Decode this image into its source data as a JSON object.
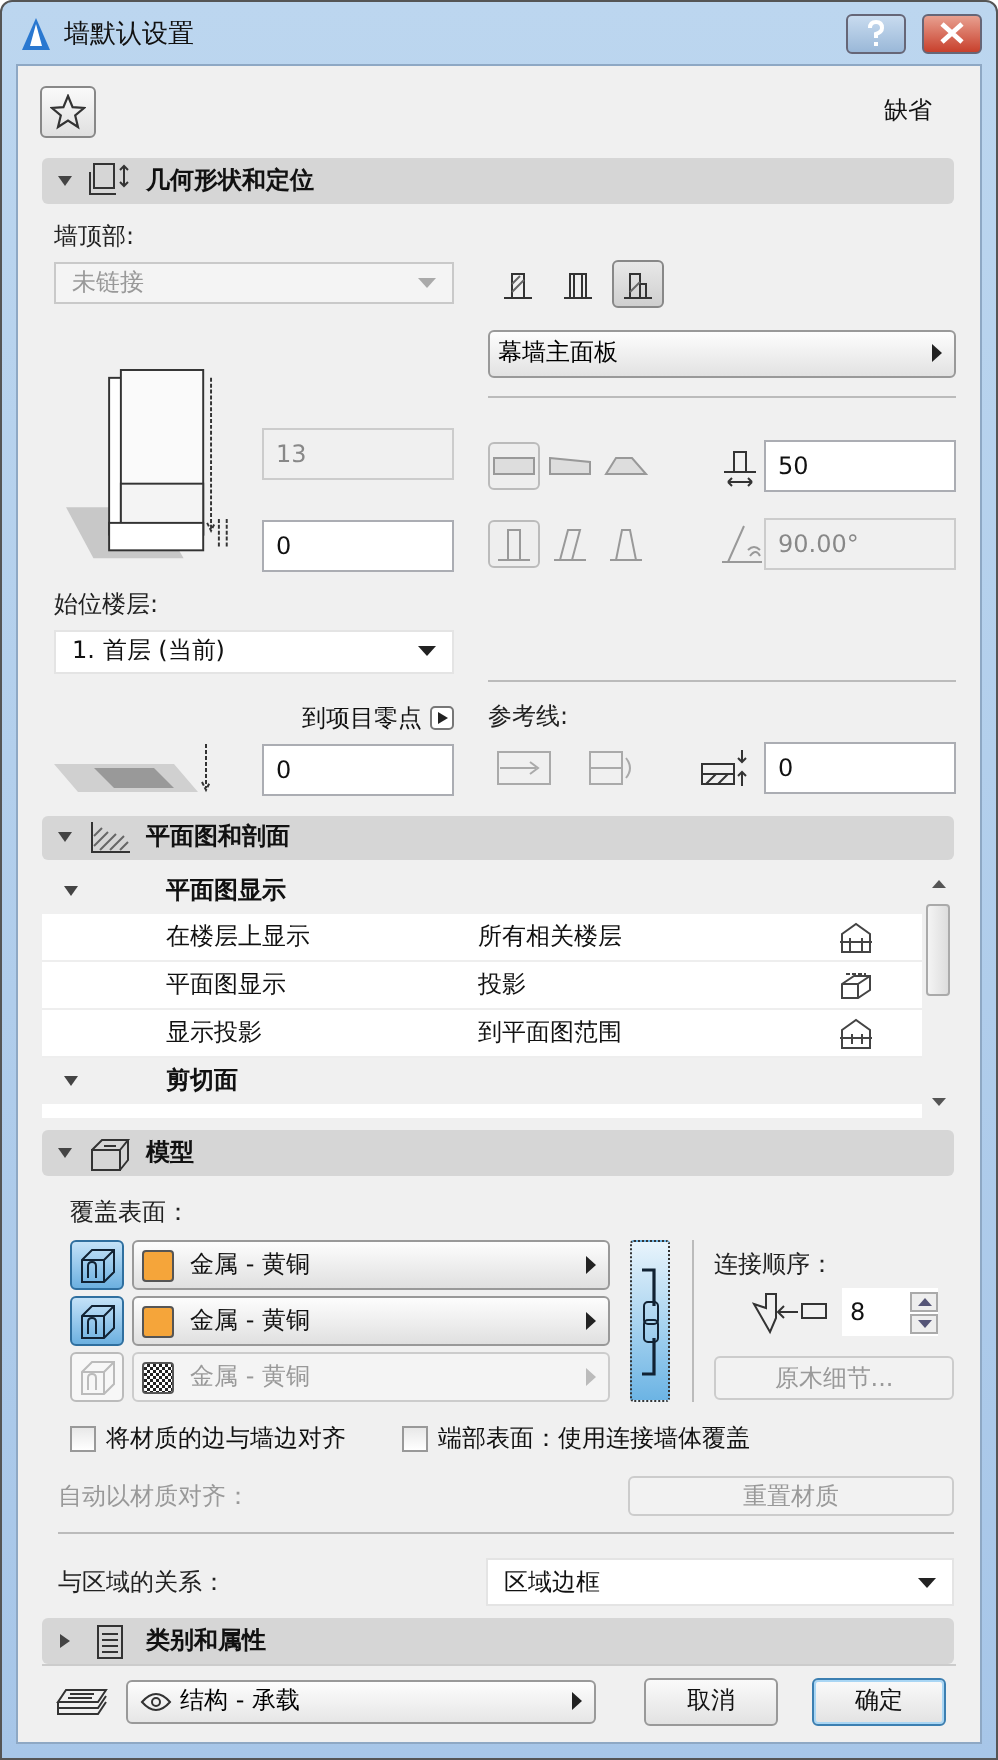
{
  "window": {
    "title": "墙默认设置"
  },
  "favorites": {
    "label": "缺省"
  },
  "geometry": {
    "title": "几何形状和定位",
    "expanded": true,
    "top_link": {
      "label": "墙顶部:",
      "value": "未链接",
      "disabled": true
    },
    "height_field": {
      "value": "13",
      "disabled": true
    },
    "base_offset_field": {
      "value": "0",
      "disabled": false
    },
    "home_story": {
      "label": "始位楼层:",
      "value": "1. 首层 (当前)"
    },
    "project_zero_link": "到项目零点",
    "zero_offset_field": {
      "value": "0",
      "disabled": false
    },
    "structure_types": [
      {
        "selected": false
      },
      {
        "selected": false
      },
      {
        "selected": true
      }
    ],
    "composite": "幕墙主面板",
    "profile_shapes": [
      {
        "selected": true
      },
      {
        "selected": false
      },
      {
        "selected": false
      }
    ],
    "thickness_field": {
      "value": "50",
      "disabled": false
    },
    "slant_types": [
      {
        "selected": true
      },
      {
        "selected": false
      },
      {
        "selected": false
      }
    ],
    "angle_field": {
      "value": "90.00°",
      "disabled": true
    },
    "reference_line": {
      "label": "参考线:"
    },
    "ref_offset_field": {
      "value": "0",
      "disabled": false
    }
  },
  "floor_plan": {
    "title": "平面图和剖面",
    "expanded": true,
    "groups": [
      {
        "title": "平面图显示",
        "expanded": true,
        "rows": [
          {
            "name": "在楼层上显示",
            "value": "所有相关楼层"
          },
          {
            "name": "平面图显示",
            "value": "投影"
          },
          {
            "name": "显示投影",
            "value": "到平面图范围"
          }
        ]
      },
      {
        "title": "剪切面",
        "expanded": true
      }
    ]
  },
  "model": {
    "title": "模型",
    "expanded": true,
    "surfaces_label": "覆盖表面：",
    "surfaces": [
      {
        "material": "金属 - 黄铜",
        "kind": "color",
        "color": "#f5a53a",
        "selected": true,
        "disabled": false
      },
      {
        "material": "金属 - 黄铜",
        "kind": "color",
        "color": "#f5a53a",
        "selected": true,
        "disabled": false
      },
      {
        "material": "金属 - 黄铜",
        "kind": "pattern",
        "selected": false,
        "disabled": true
      }
    ],
    "chain_linked": true,
    "connection_order": {
      "label": "连接顺序：",
      "value": "8"
    },
    "log_details": {
      "label": "原木细节...",
      "disabled": true
    },
    "checkboxes": [
      {
        "label": "将材质的边与墙边对齐",
        "checked": false
      },
      {
        "label": "端部表面：使用连接墙体覆盖",
        "checked": false
      }
    ],
    "auto_align": {
      "label": "自动以材质对齐：",
      "disabled": true
    },
    "reset_button": {
      "label": "重置材质",
      "disabled": true
    },
    "zone_relation": {
      "label": "与区域的关系：",
      "value": "区域边框"
    }
  },
  "classification": {
    "title": "类别和属性",
    "expanded": false
  },
  "footer": {
    "layer": "结构 - 承载",
    "buttons": [
      {
        "label": "取消",
        "default": false
      },
      {
        "label": "确定",
        "default": true
      }
    ]
  }
}
